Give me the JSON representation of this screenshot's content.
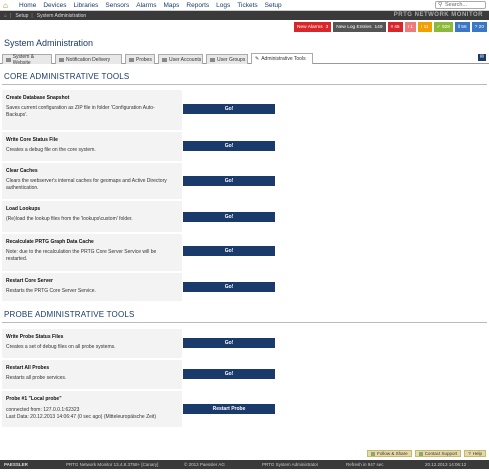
{
  "nav": {
    "items": [
      "Home",
      "Devices",
      "Libraries",
      "Sensors",
      "Alarms",
      "Maps",
      "Reports",
      "Logs",
      "Tickets",
      "Setup"
    ],
    "search_placeholder": "Search..."
  },
  "breadcrumb": {
    "items": [
      "Setup",
      "System Administration"
    ],
    "brand": "PRTG NETWORK MONITOR"
  },
  "page": {
    "title": "System Administration"
  },
  "badges": [
    {
      "label": "New Alarms",
      "value": "3",
      "color": "#d9262a"
    },
    {
      "label": "New Log Entries",
      "value": "149",
      "color": "#555555"
    },
    {
      "label": "45",
      "value": "",
      "color": "#d9262a"
    },
    {
      "label": "1",
      "value": "",
      "color": "#ec7b7b"
    },
    {
      "label": "11",
      "value": "",
      "color": "#f0a000"
    },
    {
      "label": "928",
      "value": "",
      "color": "#8bb93a"
    },
    {
      "label": "56",
      "value": "",
      "color": "#3a77c4"
    },
    {
      "label": "20",
      "value": "",
      "color": "#3a77c4"
    }
  ],
  "tabs": [
    {
      "label": "System & Website"
    },
    {
      "label": "Notification Delivery"
    },
    {
      "label": "Probes"
    },
    {
      "label": "User Accounts"
    },
    {
      "label": "User Groups"
    },
    {
      "label": "Administrative Tools"
    }
  ],
  "sections": {
    "core": "CORE ADMINISTRATIVE TOOLS",
    "probe": "PROBE ADMINISTRATIVE TOOLS"
  },
  "core_rows": [
    {
      "title": "Create Database Snapshot",
      "desc": "Saves current configuration as ZIP file in folder 'Configuration Auto-Backups'.",
      "button": "Go!"
    },
    {
      "title": "Write Core Status File",
      "desc": "Creates a debug file on the core system.",
      "button": "Go!"
    },
    {
      "title": "Clear Caches",
      "desc": "Clears the webserver's internal caches for geomaps and Active Directory authentication.",
      "button": "Go!"
    },
    {
      "title": "Load Lookups",
      "desc": "(Re)load the lookup files from the 'lookups\\custom' folder.",
      "button": "Go!"
    },
    {
      "title": "Recalculate PRTG Graph Data Cache",
      "desc": "Note: due to the recalculation the PRTG Core Server Service will be restarted.",
      "button": "Go!"
    },
    {
      "title": "Restart Core Server",
      "desc": "Restarts the PRTG Core Server Service.",
      "button": "Go!"
    }
  ],
  "probe_rows": [
    {
      "title": "Write Probe Status Files",
      "desc": "Creates a set of debug files on all probe systems.",
      "button": "Go!"
    },
    {
      "title": "Restart All Probes",
      "desc": "Restarts all probe services.",
      "button": "Go!"
    },
    {
      "title": "Probe #1 \"Local probe\"",
      "desc": "connected from: 127.0.0.1:62323",
      "desc2": "Last Data: 20.12.2013 14:06:47 (0 sec ago) (Mitteleuropäische Zeit)",
      "button": "Restart Probe"
    }
  ],
  "footer": {
    "buttons": [
      "Follow & Share",
      "Contact Support",
      "Help"
    ],
    "logo": "PAESSLER",
    "version": "PRTG Network Monitor 13.4.8.3758+ [Canary]",
    "copyright": "© 2013 Paessler AG",
    "user": "PRTG System Administrator",
    "refresh": "Refresh in 947 sec",
    "datetime": "20.12.2013 14:06:12"
  }
}
